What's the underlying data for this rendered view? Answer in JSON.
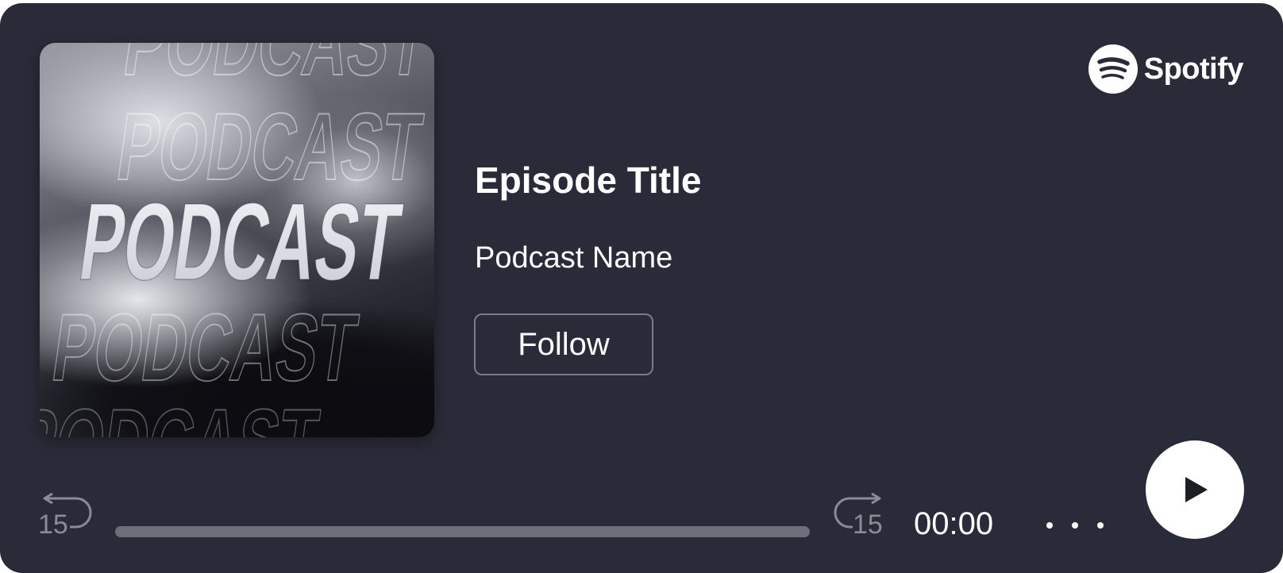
{
  "episode": {
    "title": "Episode Title",
    "podcast_name": "Podcast Name"
  },
  "artwork": {
    "text_main": "PODCAST",
    "text_echo": "PODCAST"
  },
  "brand": {
    "name": "Spotify"
  },
  "buttons": {
    "follow_label": "Follow"
  },
  "controls": {
    "skip_back_seconds": "15",
    "skip_forward_seconds": "15",
    "elapsed_time": "00:00",
    "progress": 0,
    "play_icon": "play-icon",
    "more_icon": "more-horizontal-icon"
  },
  "colors": {
    "card_background": "#2a2b38",
    "track": "#6d6e7a",
    "button_border": "#7b7c88"
  }
}
